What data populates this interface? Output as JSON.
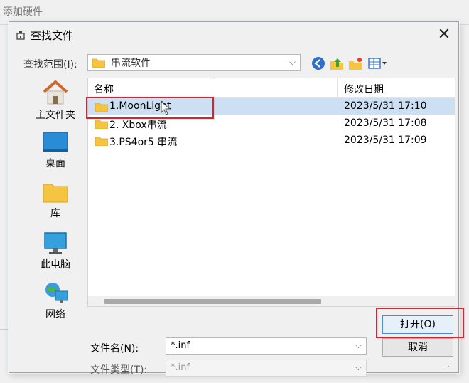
{
  "background": {
    "title": "添加硬件"
  },
  "dialog": {
    "title": "查找文件",
    "lookin_label": "查找范围(I):",
    "lookin_value": "串流软件",
    "toolbar": [
      "back-icon",
      "up-folder-icon",
      "new-folder-icon",
      "view-menu-icon"
    ],
    "sidebar": [
      {
        "label": "主文件夹",
        "icon": "home-icon"
      },
      {
        "label": "桌面",
        "icon": "desktop-icon"
      },
      {
        "label": "库",
        "icon": "library-folder-icon"
      },
      {
        "label": "此电脑",
        "icon": "computer-icon"
      },
      {
        "label": "网络",
        "icon": "network-icon"
      }
    ],
    "columns": {
      "name": "名称",
      "date": "修改日期"
    },
    "files": [
      {
        "name": "1.MoonLight",
        "date": "2023/5/31 17:10",
        "selected": true
      },
      {
        "name": "2. Xbox串流",
        "date": "2023/5/31 17:08",
        "selected": false
      },
      {
        "name": "3.PS4or5 串流",
        "date": "2023/5/31 17:09",
        "selected": false
      }
    ],
    "filename_label": "文件名(N):",
    "filename_value": "*.inf",
    "filetype_label": "文件类型(T):",
    "filetype_value": "*.inf",
    "open_button": "打开(O)",
    "cancel_button": "取消"
  },
  "colors": {
    "selection": "#cde0f3",
    "highlight_box": "#e0202a",
    "folder": "#f5c542"
  }
}
